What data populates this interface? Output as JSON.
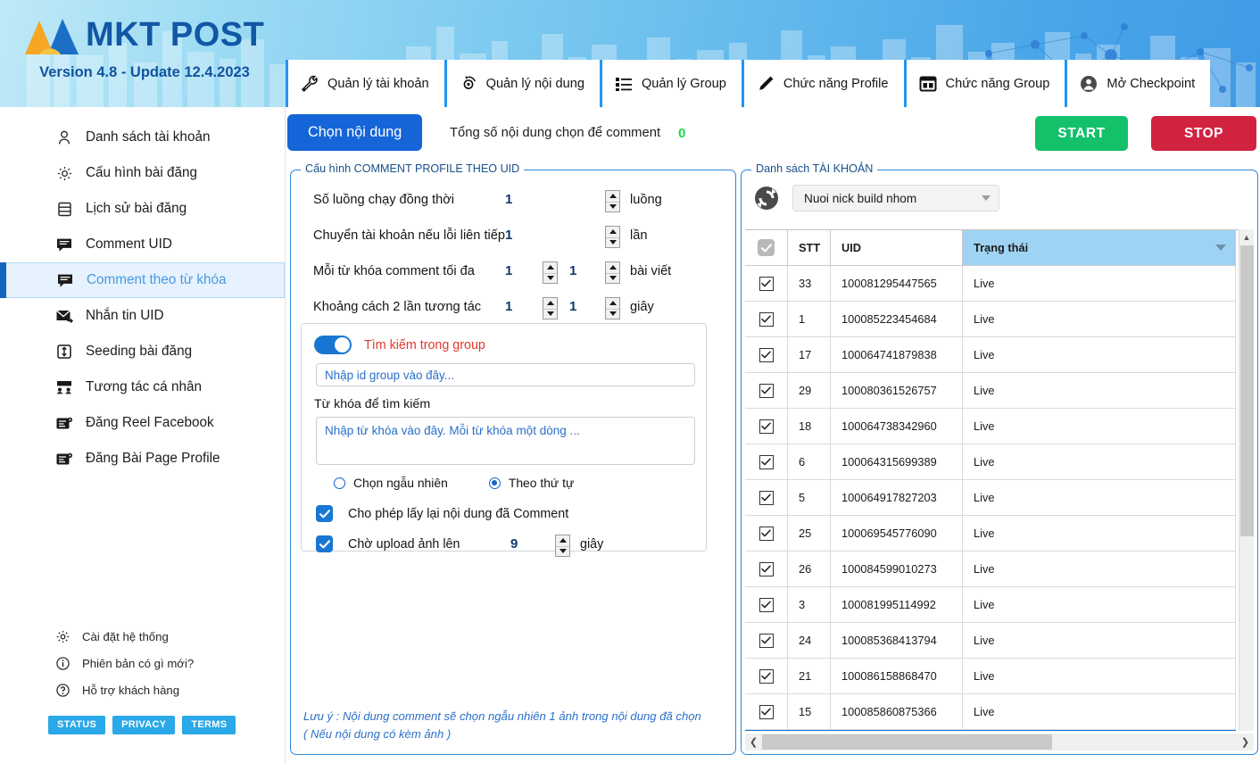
{
  "app": {
    "logo_text": "MKT POST",
    "version": "Version 4.8 - Update 12.4.2023",
    "accent_blue": "#1565d8",
    "start_color": "#14c06a",
    "stop_color": "#d12340"
  },
  "tabs": [
    {
      "label": "Quản lý tài khoản",
      "icon": "wrench-icon"
    },
    {
      "label": "Quản lý nội dung",
      "icon": "content-refresh-icon"
    },
    {
      "label": "Quản lý Group",
      "icon": "list-icon"
    },
    {
      "label": "Chức năng Profile",
      "icon": "pencil-icon"
    },
    {
      "label": "Chức năng Group",
      "icon": "window-grid-icon"
    },
    {
      "label": "Mở Checkpoint",
      "icon": "user-circle-icon"
    }
  ],
  "sidebar": {
    "items": [
      {
        "label": "Danh sách tài khoản",
        "icon": "person-icon",
        "active": false
      },
      {
        "label": "Cấu hình bài đăng",
        "icon": "gear-icon",
        "active": false
      },
      {
        "label": "Lịch sử bài đăng",
        "icon": "database-icon",
        "active": false
      },
      {
        "label": "Comment UID",
        "icon": "comment-icon",
        "active": false
      },
      {
        "label": "Comment theo từ khóa",
        "icon": "comment-icon",
        "active": true
      },
      {
        "label": "Nhắn tin UID",
        "icon": "mail-send-icon",
        "active": false
      },
      {
        "label": "Seeding bài đăng",
        "icon": "seeding-icon",
        "active": false
      },
      {
        "label": "Tương tác cá nhân",
        "icon": "people-icon",
        "active": false
      },
      {
        "label": "Đăng Reel Facebook",
        "icon": "reel-icon",
        "active": false
      },
      {
        "label": "Đăng Bài Page Profile",
        "icon": "page-post-icon",
        "active": false
      }
    ],
    "bottom_items": [
      {
        "label": "Cài đặt hệ thống",
        "icon": "gear-icon"
      },
      {
        "label": "Phiên bản có gì mới?",
        "icon": "info-icon"
      },
      {
        "label": "Hỗ trợ khách hàng",
        "icon": "question-icon"
      }
    ],
    "pills": [
      "STATUS",
      "PRIVACY",
      "TERMS"
    ]
  },
  "toolbar": {
    "choose_content_label": "Chọn nội dung",
    "total_label": "Tổng số nội dung chọn để comment",
    "total_count": "0",
    "start_label": "START",
    "stop_label": "STOP"
  },
  "config_panel": {
    "legend": "Cấu hình COMMENT PROFILE THEO UID",
    "rows": [
      {
        "label": "Số luồng chạy đồng thời",
        "value1": "1",
        "value2": "",
        "unit": "luồng",
        "has_mid_spinner": false
      },
      {
        "label": "Chuyển tài khoản nếu lỗi liên tiếp",
        "value1": "1",
        "value2": "",
        "unit": "lần",
        "has_mid_spinner": false
      },
      {
        "label": "Mỗi từ khóa comment tối đa",
        "value1": "1",
        "value2": "1",
        "unit": "bài viết",
        "has_mid_spinner": true
      },
      {
        "label": "Khoảng cách 2 lần tương tác",
        "value1": "1",
        "value2": "1",
        "unit": "giây",
        "has_mid_spinner": true
      }
    ],
    "toggle": {
      "label": "Tìm kiếm trong group",
      "on": true,
      "color": "#e2392f"
    },
    "group_input": {
      "value": "",
      "placeholder": "Nhập id group vào đây..."
    },
    "keyword_label": "Từ khóa để tìm kiếm",
    "keyword_area": {
      "value": "",
      "placeholder": "Nhập từ khóa vào đây. Mỗi từ khóa một dòng ..."
    },
    "radios": [
      {
        "label": "Chọn ngẫu nhiên",
        "selected": false
      },
      {
        "label": "Theo thứ tự",
        "selected": true
      }
    ],
    "checkboxes": [
      {
        "label": "Cho phép lấy lại nội dung đã Comment",
        "checked": true
      },
      {
        "label": "Chờ upload ảnh lên",
        "checked": true,
        "value": "9",
        "unit": "giây"
      }
    ],
    "note_line1": "Lưu ý : Nội dung comment sẽ chọn ngẫu nhiên 1 ảnh trong nội dung đã chọn",
    "note_line2": "( Nếu nội dung có kèm ảnh )"
  },
  "account_panel": {
    "legend": "Danh sách TÀI KHOẢN",
    "refresh_icon": "refresh-icon",
    "group_select": {
      "value": "Nuoi nick build nhom"
    },
    "columns": [
      "STT",
      "UID",
      "Trạng thái"
    ],
    "header_checked": true,
    "rows": [
      {
        "checked": true,
        "stt": "33",
        "uid": "100081295447565",
        "status": "Live"
      },
      {
        "checked": true,
        "stt": "1",
        "uid": "100085223454684",
        "status": "Live"
      },
      {
        "checked": true,
        "stt": "17",
        "uid": "100064741879838",
        "status": "Live"
      },
      {
        "checked": true,
        "stt": "29",
        "uid": "100080361526757",
        "status": "Live"
      },
      {
        "checked": true,
        "stt": "18",
        "uid": "100064738342960",
        "status": "Live"
      },
      {
        "checked": true,
        "stt": "6",
        "uid": "100064315699389",
        "status": "Live"
      },
      {
        "checked": true,
        "stt": "5",
        "uid": "100064917827203",
        "status": "Live"
      },
      {
        "checked": true,
        "stt": "25",
        "uid": "100069545776090",
        "status": "Live"
      },
      {
        "checked": true,
        "stt": "26",
        "uid": "100084599010273",
        "status": "Live"
      },
      {
        "checked": true,
        "stt": "3",
        "uid": "100081995114992",
        "status": "Live"
      },
      {
        "checked": true,
        "stt": "24",
        "uid": "100085368413794",
        "status": "Live"
      },
      {
        "checked": true,
        "stt": "21",
        "uid": "100086158868470",
        "status": "Live"
      },
      {
        "checked": true,
        "stt": "15",
        "uid": "100085860875366",
        "status": "Live"
      }
    ]
  }
}
